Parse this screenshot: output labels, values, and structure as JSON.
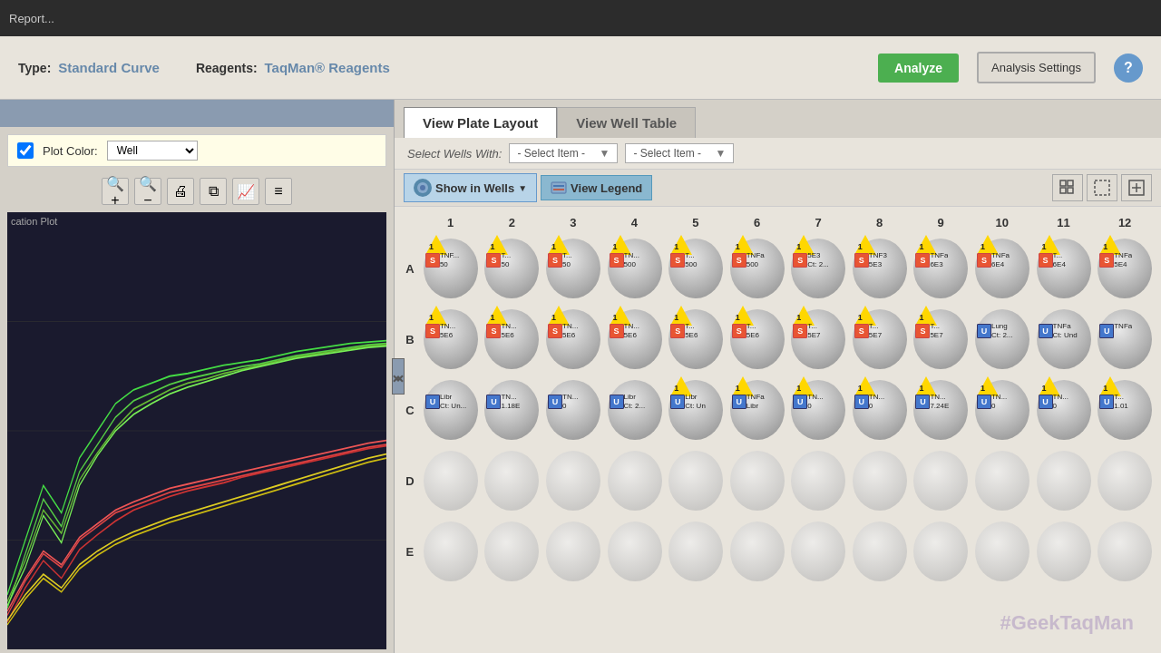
{
  "title_bar": {
    "text": "Report..."
  },
  "top_bar": {
    "type_label": "Type:",
    "type_value": "Standard Curve",
    "reagents_label": "Reagents:",
    "reagents_value": "TaqMan® Reagents",
    "analyze_btn": "Analyze",
    "analysis_settings_btn": "Analysis Settings",
    "help_btn": "?"
  },
  "left_panel": {
    "plot_color_label": "Plot Color:",
    "plot_color_value": "Well",
    "chart_label": "cation Plot",
    "tools": {
      "zoom_in": "+",
      "zoom_out": "−",
      "print": "🖨",
      "copy": "⧉",
      "chart": "📈",
      "list": "≡"
    }
  },
  "right_panel": {
    "tabs": [
      {
        "label": "View Plate Layout",
        "active": true
      },
      {
        "label": "View Well Table",
        "active": false
      }
    ],
    "select_wells_label": "Select Wells With:",
    "select_item_1": "- Select Item -",
    "select_item_2": "- Select Item -",
    "show_in_wells_btn": "Show in Wells",
    "view_legend_btn": "View Legend",
    "col_headers": [
      "1",
      "2",
      "3",
      "4",
      "5",
      "6",
      "7",
      "8",
      "9",
      "10",
      "11",
      "12"
    ],
    "row_headers": [
      "A",
      "B",
      "C",
      "D",
      "E"
    ],
    "watermark": "#GeekTaqMan"
  }
}
